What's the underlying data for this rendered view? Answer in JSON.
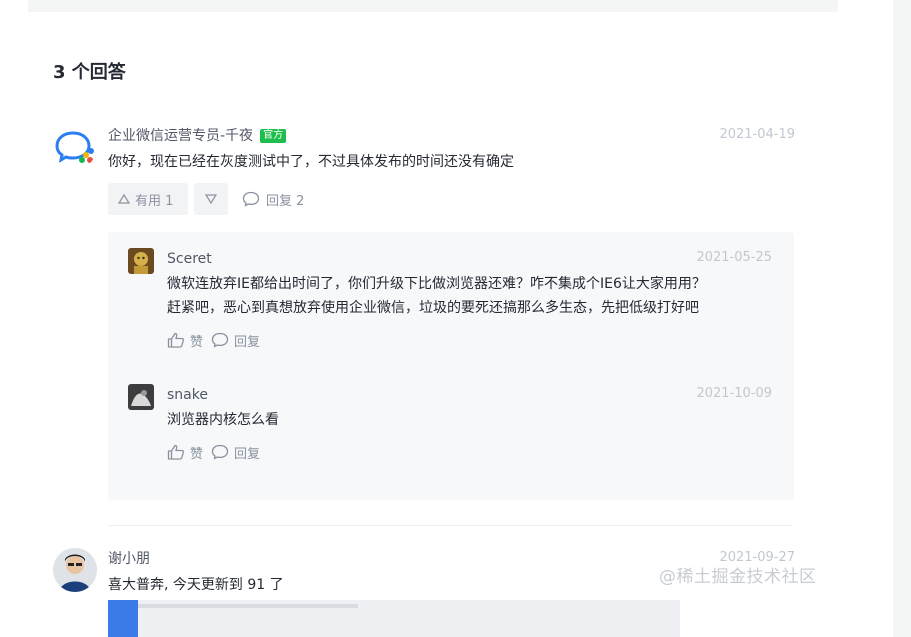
{
  "section_title": "3 个回答",
  "answers": [
    {
      "user": "企业微信运营专员-千夜",
      "badge": "官方",
      "date": "2021-04-19",
      "content": "你好，现在已经在灰度测试中了，不过具体发布的时间还没有确定",
      "upvote_label": "有用 1",
      "reply_label": "回复 2",
      "replies": [
        {
          "user": "Sceret",
          "date": "2021-05-25",
          "content_line1": "微软连放弃IE都给出时间了，你们升级下比做浏览器还难？咋不集成个IE6让大家用用？",
          "content_line2": "赶紧吧，恶心到真想放弃使用企业微信，垃圾的要死还搞那么多生态，先把低级打好吧",
          "like_label": "赞",
          "reply_label": "回复"
        },
        {
          "user": "snake",
          "date": "2021-10-09",
          "content": "浏览器内核怎么看",
          "like_label": "赞",
          "reply_label": "回复"
        }
      ]
    },
    {
      "user": "谢小朋",
      "date": "2021-09-27",
      "content": "喜大普奔, 今天更新到 91 了"
    }
  ],
  "watermark": "@稀土掘金技术社区",
  "colors": {
    "badge": "#1fbd4c",
    "username": "#515767",
    "muted": "#8a919f",
    "date": "#c2c8d1",
    "reply_bg": "#f7f8fa"
  },
  "icons": [
    "wecom-logo-icon",
    "upvote-triangle-icon",
    "downvote-triangle-icon",
    "comment-bubble-icon",
    "thumb-up-icon"
  ]
}
